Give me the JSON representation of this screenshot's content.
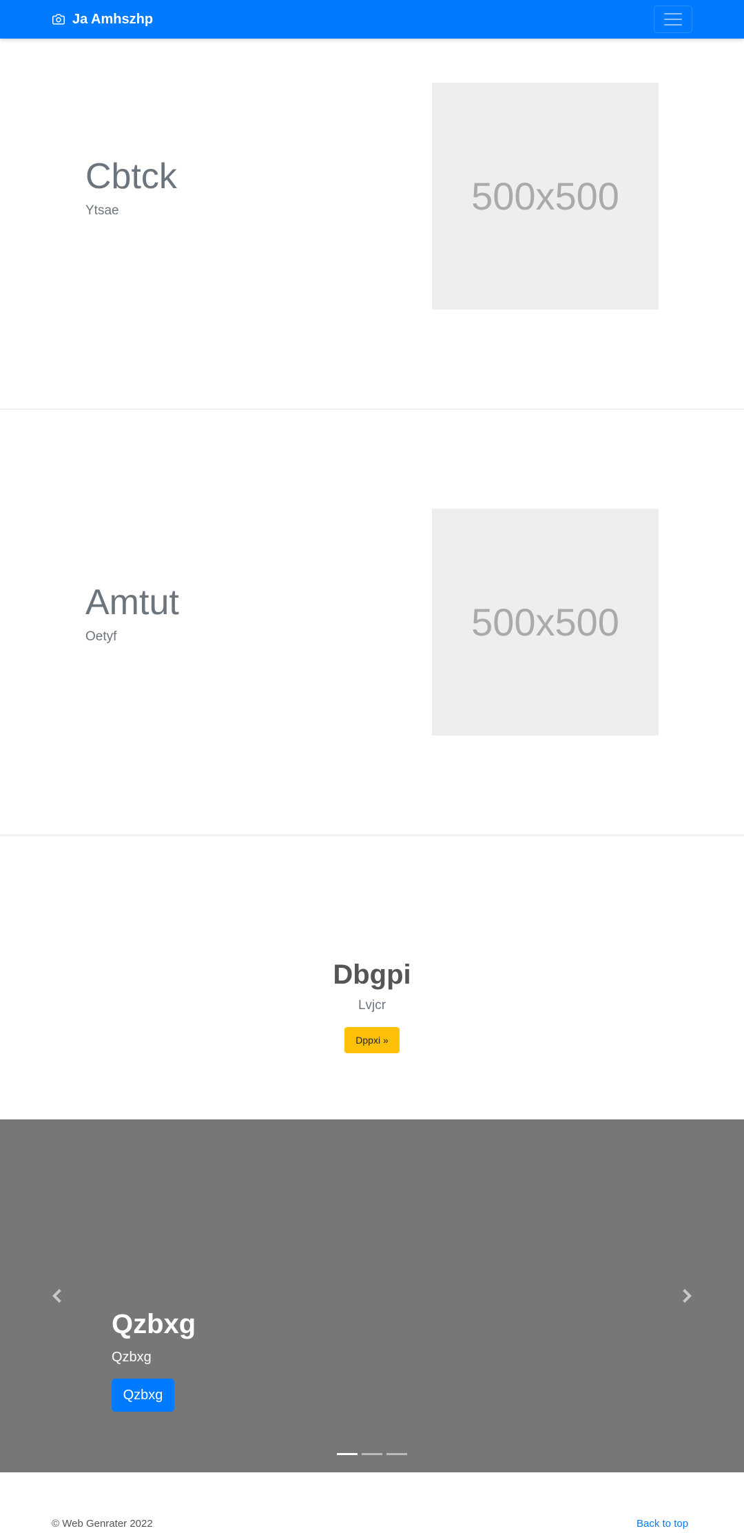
{
  "navbar": {
    "brand": "Ja Amhszhp",
    "brand_icon": "camera-icon",
    "toggler_icon": "hamburger-menu-icon"
  },
  "features": [
    {
      "heading": "Cbtck",
      "lead": "Ytsae",
      "placeholder": "500x500"
    },
    {
      "heading": "Amtut",
      "lead": "Oetyf",
      "placeholder": "500x500"
    }
  ],
  "cta": {
    "title": "Dbgpi",
    "lead": "Lvjcr",
    "button": "Dppxi »"
  },
  "carousel": {
    "title": "Qzbxg",
    "text": "Qzbxg",
    "button": "Qzbxg",
    "prev_icon": "chevron-left-icon",
    "next_icon": "chevron-right-icon",
    "indicator_count": 3,
    "active_indicator": 1
  },
  "footer": {
    "copyright": "© Web Genrater 2022",
    "back_to_top": "Back to top"
  },
  "colors": {
    "primary": "#007bff",
    "warning": "#ffc107",
    "carousel_bg": "#777777",
    "placeholder_bg": "#eeeeee"
  }
}
